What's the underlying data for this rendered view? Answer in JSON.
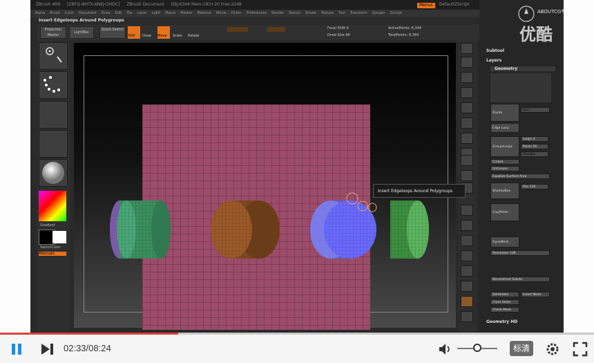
{
  "app": {
    "title_items": [
      "ZBrush 4R6",
      "[ZBFQ-NHTX-ANEJ-OHDC]",
      "ZBrush Document",
      "Obj:6344  Mem:183+20  Free:2248"
    ],
    "menu": [
      "Alpha",
      "Brush",
      "Color",
      "Document",
      "Draw",
      "Edit",
      "File",
      "Layer",
      "Light",
      "Macro",
      "Marker",
      "Material",
      "Movie",
      "Picker",
      "Preferences",
      "Render",
      "Stencil",
      "Stroke",
      "Texture",
      "Tool",
      "Transform",
      "Zplugin",
      "Zscript"
    ],
    "top_right": {
      "menus_label": "Menus",
      "script_label": "DefaultZScript"
    },
    "hint": "Insert Edgeloops Around Polygroups"
  },
  "toolbar": {
    "projection_master": "Projection Master",
    "lightbox": "LightBox",
    "quick_sketch": "Quick Sketch",
    "edit": "Edit",
    "draw": "Draw",
    "move": "Move",
    "scale": "Scale",
    "rotate": "Rotate",
    "focal_shift": "Focal Shift 0",
    "draw_size": "Draw Size 64",
    "active_points": "ActivePoints: 6,344",
    "total_points": "TotalPoints: 6,344"
  },
  "left_shelf": {
    "gradient": "Gradient",
    "switch_color": "SwitchColor",
    "alternate": "Alternate"
  },
  "tooltip": "Insert Edgeloops Around Polygroups",
  "right_tray": {
    "subtool": "Subtool",
    "layers": "Layers",
    "geometry": "Geometry",
    "divide": "Divide",
    "smt": "Smt",
    "edge_loop": "Edge Loop",
    "group_loops": "GroupsLoops",
    "loops": "Loops 4",
    "polish": "Polish 56",
    "triangle": "Triangle",
    "crease": "Crease",
    "uncrease": "UnCrease",
    "equalize": "Equalize Surface Area",
    "shadowbox": "ShadowBox",
    "res": "Res 128",
    "clay_polish": "ClayPolish",
    "dyna_mesh": "DynaMesh",
    "resolution": "Resolution 128",
    "reconstruct": "Reconstruct Subdiv",
    "del_hidden": "DelHidden",
    "insert_mesh": "Insert Mesh",
    "close_holes": "Close Holes",
    "check_mesh": "Check Mesh",
    "geometry_hd": "Geometry HD"
  },
  "watermark": {
    "site": "ABOUTCG专业教学",
    "brand": "优酷"
  },
  "player": {
    "time": "02:33/08:24",
    "quality": "标清",
    "progress": 0.3,
    "volume": 0.5,
    "accent": "#e04040"
  }
}
